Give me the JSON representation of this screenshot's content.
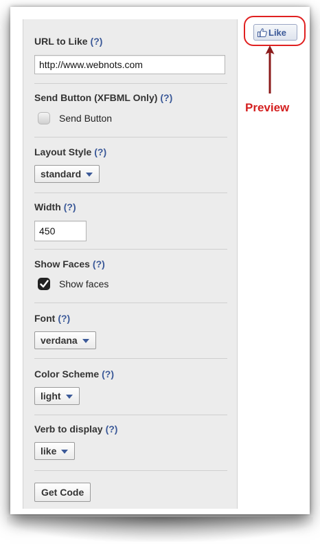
{
  "form": {
    "url_label": "URL to Like",
    "url_help": "(?)",
    "url_value": "http://www.webnots.com",
    "send_label": "Send Button (XFBML Only)",
    "send_help": "(?)",
    "send_toggle_text": "Send Button",
    "send_checked": false,
    "layout_label": "Layout Style",
    "layout_help": "(?)",
    "layout_value": "standard",
    "width_label": "Width",
    "width_help": "(?)",
    "width_value": "450",
    "faces_label": "Show Faces",
    "faces_help": "(?)",
    "faces_toggle_text": "Show faces",
    "faces_checked": true,
    "font_label": "Font",
    "font_help": "(?)",
    "font_value": "verdana",
    "color_label": "Color Scheme",
    "color_help": "(?)",
    "color_value": "light",
    "verb_label": "Verb to display",
    "verb_help": "(?)",
    "verb_value": "like",
    "get_code_label": "Get Code"
  },
  "preview": {
    "like_button_label": "Like",
    "annotation_label": "Preview",
    "annotation_color": "#d42020",
    "brand_color": "#3b5998"
  },
  "icons": {
    "thumb": "thumbs-up-icon",
    "caret": "chevron-down-icon",
    "check": "check-icon",
    "arrow": "arrow-up-icon"
  }
}
